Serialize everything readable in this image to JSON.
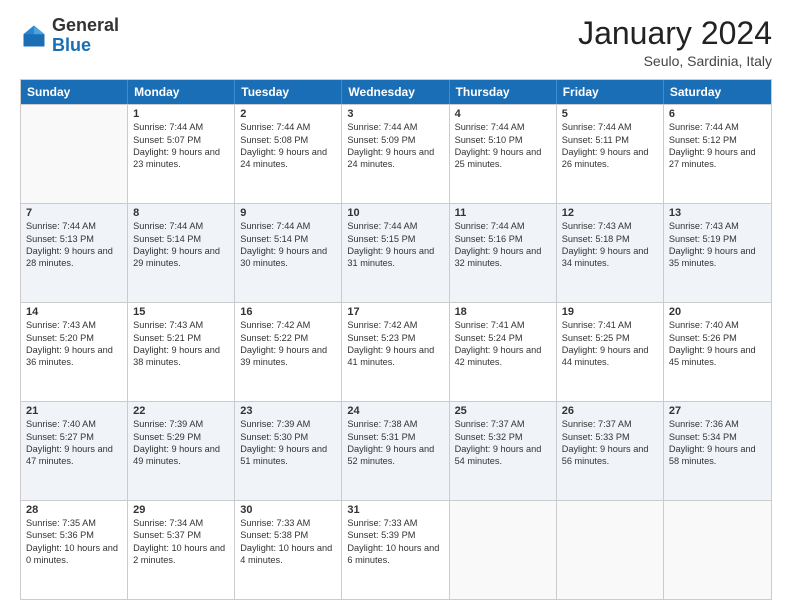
{
  "header": {
    "logo_general": "General",
    "logo_blue": "Blue",
    "month_title": "January 2024",
    "location": "Seulo, Sardinia, Italy"
  },
  "days_of_week": [
    "Sunday",
    "Monday",
    "Tuesday",
    "Wednesday",
    "Thursday",
    "Friday",
    "Saturday"
  ],
  "weeks": [
    [
      {
        "day": "",
        "sunrise": "",
        "sunset": "",
        "daylight": ""
      },
      {
        "day": "1",
        "sunrise": "Sunrise: 7:44 AM",
        "sunset": "Sunset: 5:07 PM",
        "daylight": "Daylight: 9 hours and 23 minutes."
      },
      {
        "day": "2",
        "sunrise": "Sunrise: 7:44 AM",
        "sunset": "Sunset: 5:08 PM",
        "daylight": "Daylight: 9 hours and 24 minutes."
      },
      {
        "day": "3",
        "sunrise": "Sunrise: 7:44 AM",
        "sunset": "Sunset: 5:09 PM",
        "daylight": "Daylight: 9 hours and 24 minutes."
      },
      {
        "day": "4",
        "sunrise": "Sunrise: 7:44 AM",
        "sunset": "Sunset: 5:10 PM",
        "daylight": "Daylight: 9 hours and 25 minutes."
      },
      {
        "day": "5",
        "sunrise": "Sunrise: 7:44 AM",
        "sunset": "Sunset: 5:11 PM",
        "daylight": "Daylight: 9 hours and 26 minutes."
      },
      {
        "day": "6",
        "sunrise": "Sunrise: 7:44 AM",
        "sunset": "Sunset: 5:12 PM",
        "daylight": "Daylight: 9 hours and 27 minutes."
      }
    ],
    [
      {
        "day": "7",
        "sunrise": "Sunrise: 7:44 AM",
        "sunset": "Sunset: 5:13 PM",
        "daylight": "Daylight: 9 hours and 28 minutes."
      },
      {
        "day": "8",
        "sunrise": "Sunrise: 7:44 AM",
        "sunset": "Sunset: 5:14 PM",
        "daylight": "Daylight: 9 hours and 29 minutes."
      },
      {
        "day": "9",
        "sunrise": "Sunrise: 7:44 AM",
        "sunset": "Sunset: 5:14 PM",
        "daylight": "Daylight: 9 hours and 30 minutes."
      },
      {
        "day": "10",
        "sunrise": "Sunrise: 7:44 AM",
        "sunset": "Sunset: 5:15 PM",
        "daylight": "Daylight: 9 hours and 31 minutes."
      },
      {
        "day": "11",
        "sunrise": "Sunrise: 7:44 AM",
        "sunset": "Sunset: 5:16 PM",
        "daylight": "Daylight: 9 hours and 32 minutes."
      },
      {
        "day": "12",
        "sunrise": "Sunrise: 7:43 AM",
        "sunset": "Sunset: 5:18 PM",
        "daylight": "Daylight: 9 hours and 34 minutes."
      },
      {
        "day": "13",
        "sunrise": "Sunrise: 7:43 AM",
        "sunset": "Sunset: 5:19 PM",
        "daylight": "Daylight: 9 hours and 35 minutes."
      }
    ],
    [
      {
        "day": "14",
        "sunrise": "Sunrise: 7:43 AM",
        "sunset": "Sunset: 5:20 PM",
        "daylight": "Daylight: 9 hours and 36 minutes."
      },
      {
        "day": "15",
        "sunrise": "Sunrise: 7:43 AM",
        "sunset": "Sunset: 5:21 PM",
        "daylight": "Daylight: 9 hours and 38 minutes."
      },
      {
        "day": "16",
        "sunrise": "Sunrise: 7:42 AM",
        "sunset": "Sunset: 5:22 PM",
        "daylight": "Daylight: 9 hours and 39 minutes."
      },
      {
        "day": "17",
        "sunrise": "Sunrise: 7:42 AM",
        "sunset": "Sunset: 5:23 PM",
        "daylight": "Daylight: 9 hours and 41 minutes."
      },
      {
        "day": "18",
        "sunrise": "Sunrise: 7:41 AM",
        "sunset": "Sunset: 5:24 PM",
        "daylight": "Daylight: 9 hours and 42 minutes."
      },
      {
        "day": "19",
        "sunrise": "Sunrise: 7:41 AM",
        "sunset": "Sunset: 5:25 PM",
        "daylight": "Daylight: 9 hours and 44 minutes."
      },
      {
        "day": "20",
        "sunrise": "Sunrise: 7:40 AM",
        "sunset": "Sunset: 5:26 PM",
        "daylight": "Daylight: 9 hours and 45 minutes."
      }
    ],
    [
      {
        "day": "21",
        "sunrise": "Sunrise: 7:40 AM",
        "sunset": "Sunset: 5:27 PM",
        "daylight": "Daylight: 9 hours and 47 minutes."
      },
      {
        "day": "22",
        "sunrise": "Sunrise: 7:39 AM",
        "sunset": "Sunset: 5:29 PM",
        "daylight": "Daylight: 9 hours and 49 minutes."
      },
      {
        "day": "23",
        "sunrise": "Sunrise: 7:39 AM",
        "sunset": "Sunset: 5:30 PM",
        "daylight": "Daylight: 9 hours and 51 minutes."
      },
      {
        "day": "24",
        "sunrise": "Sunrise: 7:38 AM",
        "sunset": "Sunset: 5:31 PM",
        "daylight": "Daylight: 9 hours and 52 minutes."
      },
      {
        "day": "25",
        "sunrise": "Sunrise: 7:37 AM",
        "sunset": "Sunset: 5:32 PM",
        "daylight": "Daylight: 9 hours and 54 minutes."
      },
      {
        "day": "26",
        "sunrise": "Sunrise: 7:37 AM",
        "sunset": "Sunset: 5:33 PM",
        "daylight": "Daylight: 9 hours and 56 minutes."
      },
      {
        "day": "27",
        "sunrise": "Sunrise: 7:36 AM",
        "sunset": "Sunset: 5:34 PM",
        "daylight": "Daylight: 9 hours and 58 minutes."
      }
    ],
    [
      {
        "day": "28",
        "sunrise": "Sunrise: 7:35 AM",
        "sunset": "Sunset: 5:36 PM",
        "daylight": "Daylight: 10 hours and 0 minutes."
      },
      {
        "day": "29",
        "sunrise": "Sunrise: 7:34 AM",
        "sunset": "Sunset: 5:37 PM",
        "daylight": "Daylight: 10 hours and 2 minutes."
      },
      {
        "day": "30",
        "sunrise": "Sunrise: 7:33 AM",
        "sunset": "Sunset: 5:38 PM",
        "daylight": "Daylight: 10 hours and 4 minutes."
      },
      {
        "day": "31",
        "sunrise": "Sunrise: 7:33 AM",
        "sunset": "Sunset: 5:39 PM",
        "daylight": "Daylight: 10 hours and 6 minutes."
      },
      {
        "day": "",
        "sunrise": "",
        "sunset": "",
        "daylight": ""
      },
      {
        "day": "",
        "sunrise": "",
        "sunset": "",
        "daylight": ""
      },
      {
        "day": "",
        "sunrise": "",
        "sunset": "",
        "daylight": ""
      }
    ]
  ]
}
